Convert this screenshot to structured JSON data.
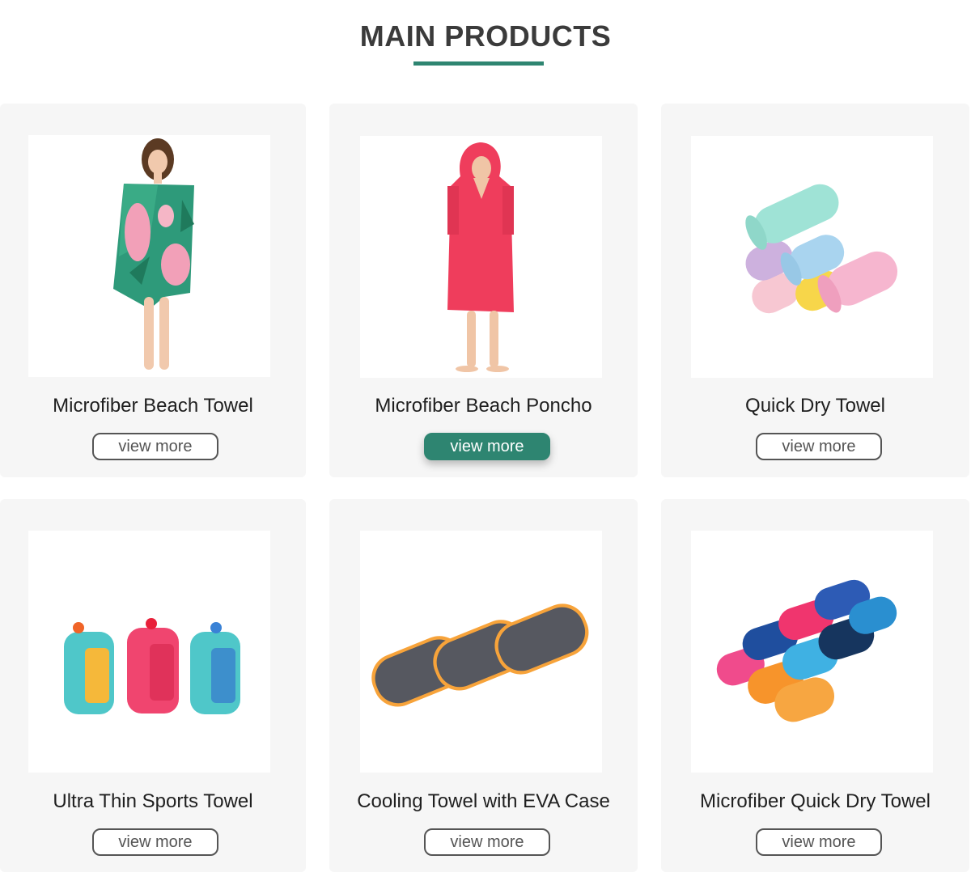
{
  "section": {
    "title": "MAIN PRODUCTS"
  },
  "theme": {
    "accent": "#2e8571",
    "card_bg": "#f6f6f6",
    "title_color": "#3b3b3b"
  },
  "products": [
    {
      "name": "Microfiber Beach Towel",
      "button": "view more",
      "button_active": false,
      "image": "woman-wrapped-in-flamingo-print-towel"
    },
    {
      "name": "Microfiber Beach Poncho",
      "button": "view more",
      "button_active": true,
      "image": "woman-in-red-hooded-poncho"
    },
    {
      "name": "Quick Dry Towel",
      "button": "view more",
      "button_active": false,
      "image": "stack-of-rolled-pastel-towels"
    },
    {
      "name": "Ultra Thin Sports Towel",
      "button": "view more",
      "button_active": false,
      "image": "three-silicone-towel-cases"
    },
    {
      "name": "Cooling Towel with EVA Case",
      "button": "view more",
      "button_active": false,
      "image": "three-gray-orange-eva-cases"
    },
    {
      "name": "Microfiber Quick Dry Towel",
      "button": "view more",
      "button_active": false,
      "image": "pile-of-rolled-colorful-towels"
    }
  ]
}
